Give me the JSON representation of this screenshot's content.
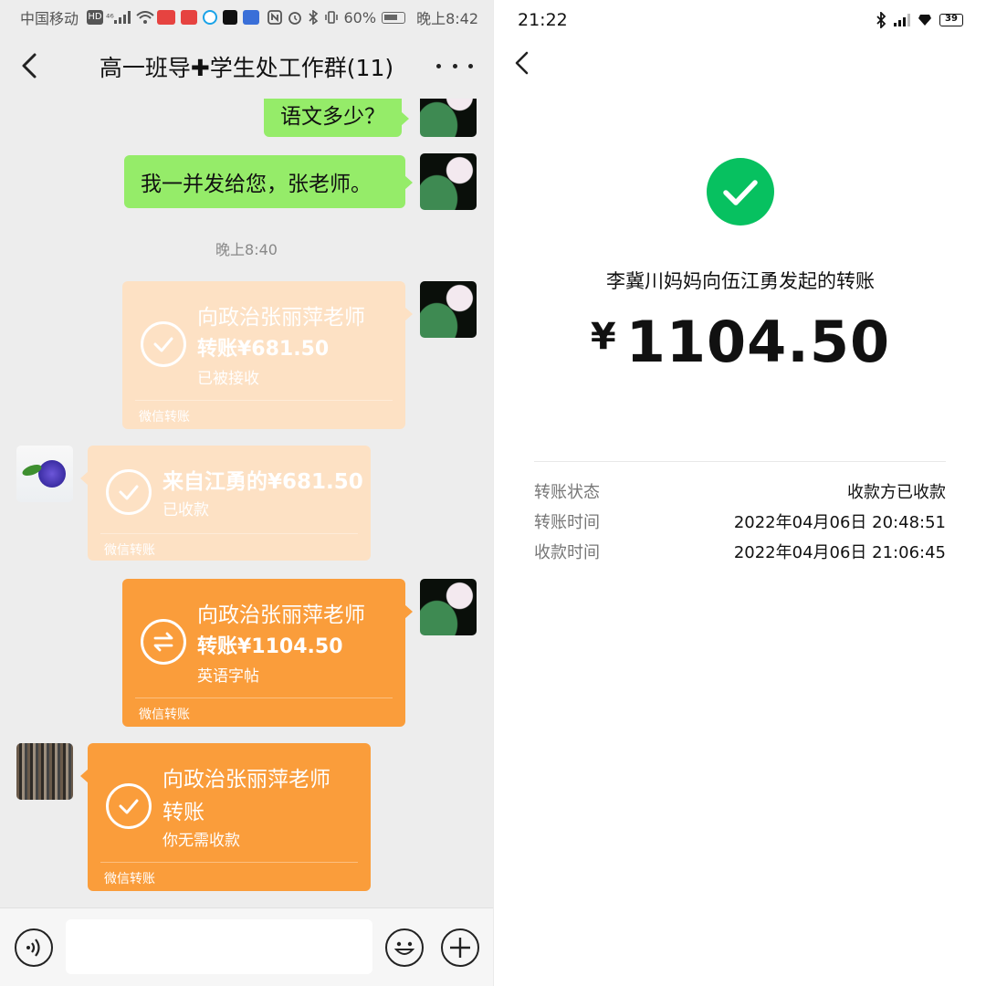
{
  "left": {
    "status_bar": {
      "carrier": "中国移动",
      "hd": "HD",
      "network": "⁴⁶",
      "battery_pct": "60%",
      "time": "晚上8:42"
    },
    "header": {
      "title": "高一班导✚学生处工作群(11)"
    },
    "messages": {
      "m1_text": "语文多少？",
      "m2_text": "我一并发给您，张老师。",
      "timestamp": "晚上8:40",
      "t1": {
        "title": "向政治张丽萍老师",
        "amount": "转账¥681.50",
        "status": "已被接收",
        "footer": "微信转账"
      },
      "t2": {
        "title": "来自江勇的¥681.50",
        "amount": "",
        "status": "已收款",
        "footer": "微信转账"
      },
      "t3": {
        "title": "向政治张丽萍老师",
        "amount": "转账¥1104.50",
        "status": "英语字帖",
        "footer": "微信转账"
      },
      "t4": {
        "title": "向政治张丽萍老师",
        "amount": "转账",
        "status": "你无需收款",
        "footer": "微信转账"
      }
    },
    "input_bar": {
      "placeholder": ""
    }
  },
  "right": {
    "status_bar": {
      "time": "21:22",
      "battery": "39"
    },
    "description": "李冀川妈妈向伍江勇发起的转账",
    "currency": "¥",
    "amount": "1104.50",
    "details": [
      {
        "label": "转账状态",
        "value": "收款方已收款"
      },
      {
        "label": "转账时间",
        "value": "2022年04月06日 20:48:51"
      },
      {
        "label": "收款时间",
        "value": "2022年04月06日 21:06:45"
      }
    ]
  },
  "colors": {
    "bubble_green": "#95ec69",
    "transfer_orange": "#fa9d3b",
    "transfer_faded": "#fde1c4",
    "wechat_green": "#07c160"
  }
}
